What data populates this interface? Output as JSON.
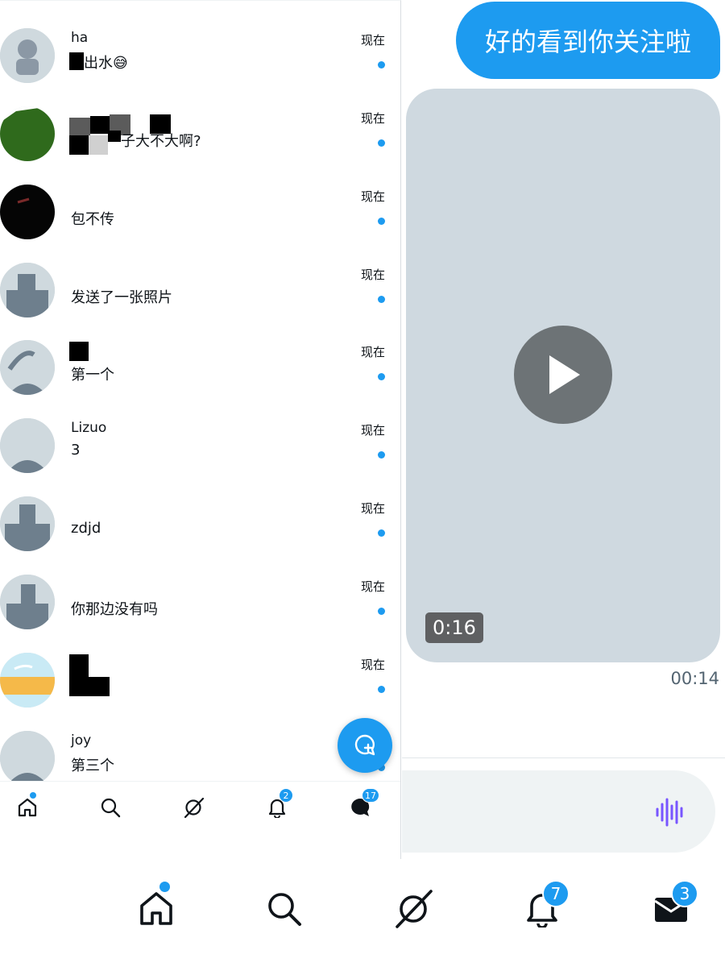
{
  "conversations": [
    {
      "name": "ha",
      "preview": "出水😅",
      "time": "现在"
    },
    {
      "name": "",
      "preview": "子大不大啊?",
      "time": "现在"
    },
    {
      "name": "",
      "preview": "包不传",
      "time": "现在"
    },
    {
      "name": "",
      "preview": "发送了一张照片",
      "time": "现在"
    },
    {
      "name": "",
      "preview": "第一个",
      "time": "现在"
    },
    {
      "name": "Lizuo",
      "preview": "3",
      "time": "现在"
    },
    {
      "name": "",
      "preview": "zdjd",
      "time": "现在"
    },
    {
      "name": "",
      "preview": "你那边没有吗",
      "time": "现在"
    },
    {
      "name": "",
      "preview": "",
      "time": "现在"
    },
    {
      "name": "joy",
      "preview": "第三个",
      "time": ""
    }
  ],
  "left_nav": {
    "notifications_badge": "2",
    "messages_badge": "17"
  },
  "chat": {
    "sent_message": "好的看到你关注啦",
    "video_duration": "0:16",
    "message_time": "00:14"
  },
  "bottom_nav": {
    "notifications_badge": "7",
    "messages_badge": "3"
  },
  "colors": {
    "accent": "#1d9bf0",
    "video_placeholder": "#cfd9e0",
    "compose_bg": "#eff3f4",
    "voice_icon": "#7856ff"
  },
  "icons": [
    "home-icon",
    "search-icon",
    "explore-icon",
    "bell-icon",
    "messages-icon",
    "mail-icon",
    "new-message-icon",
    "play-icon",
    "voice-wave-icon"
  ]
}
